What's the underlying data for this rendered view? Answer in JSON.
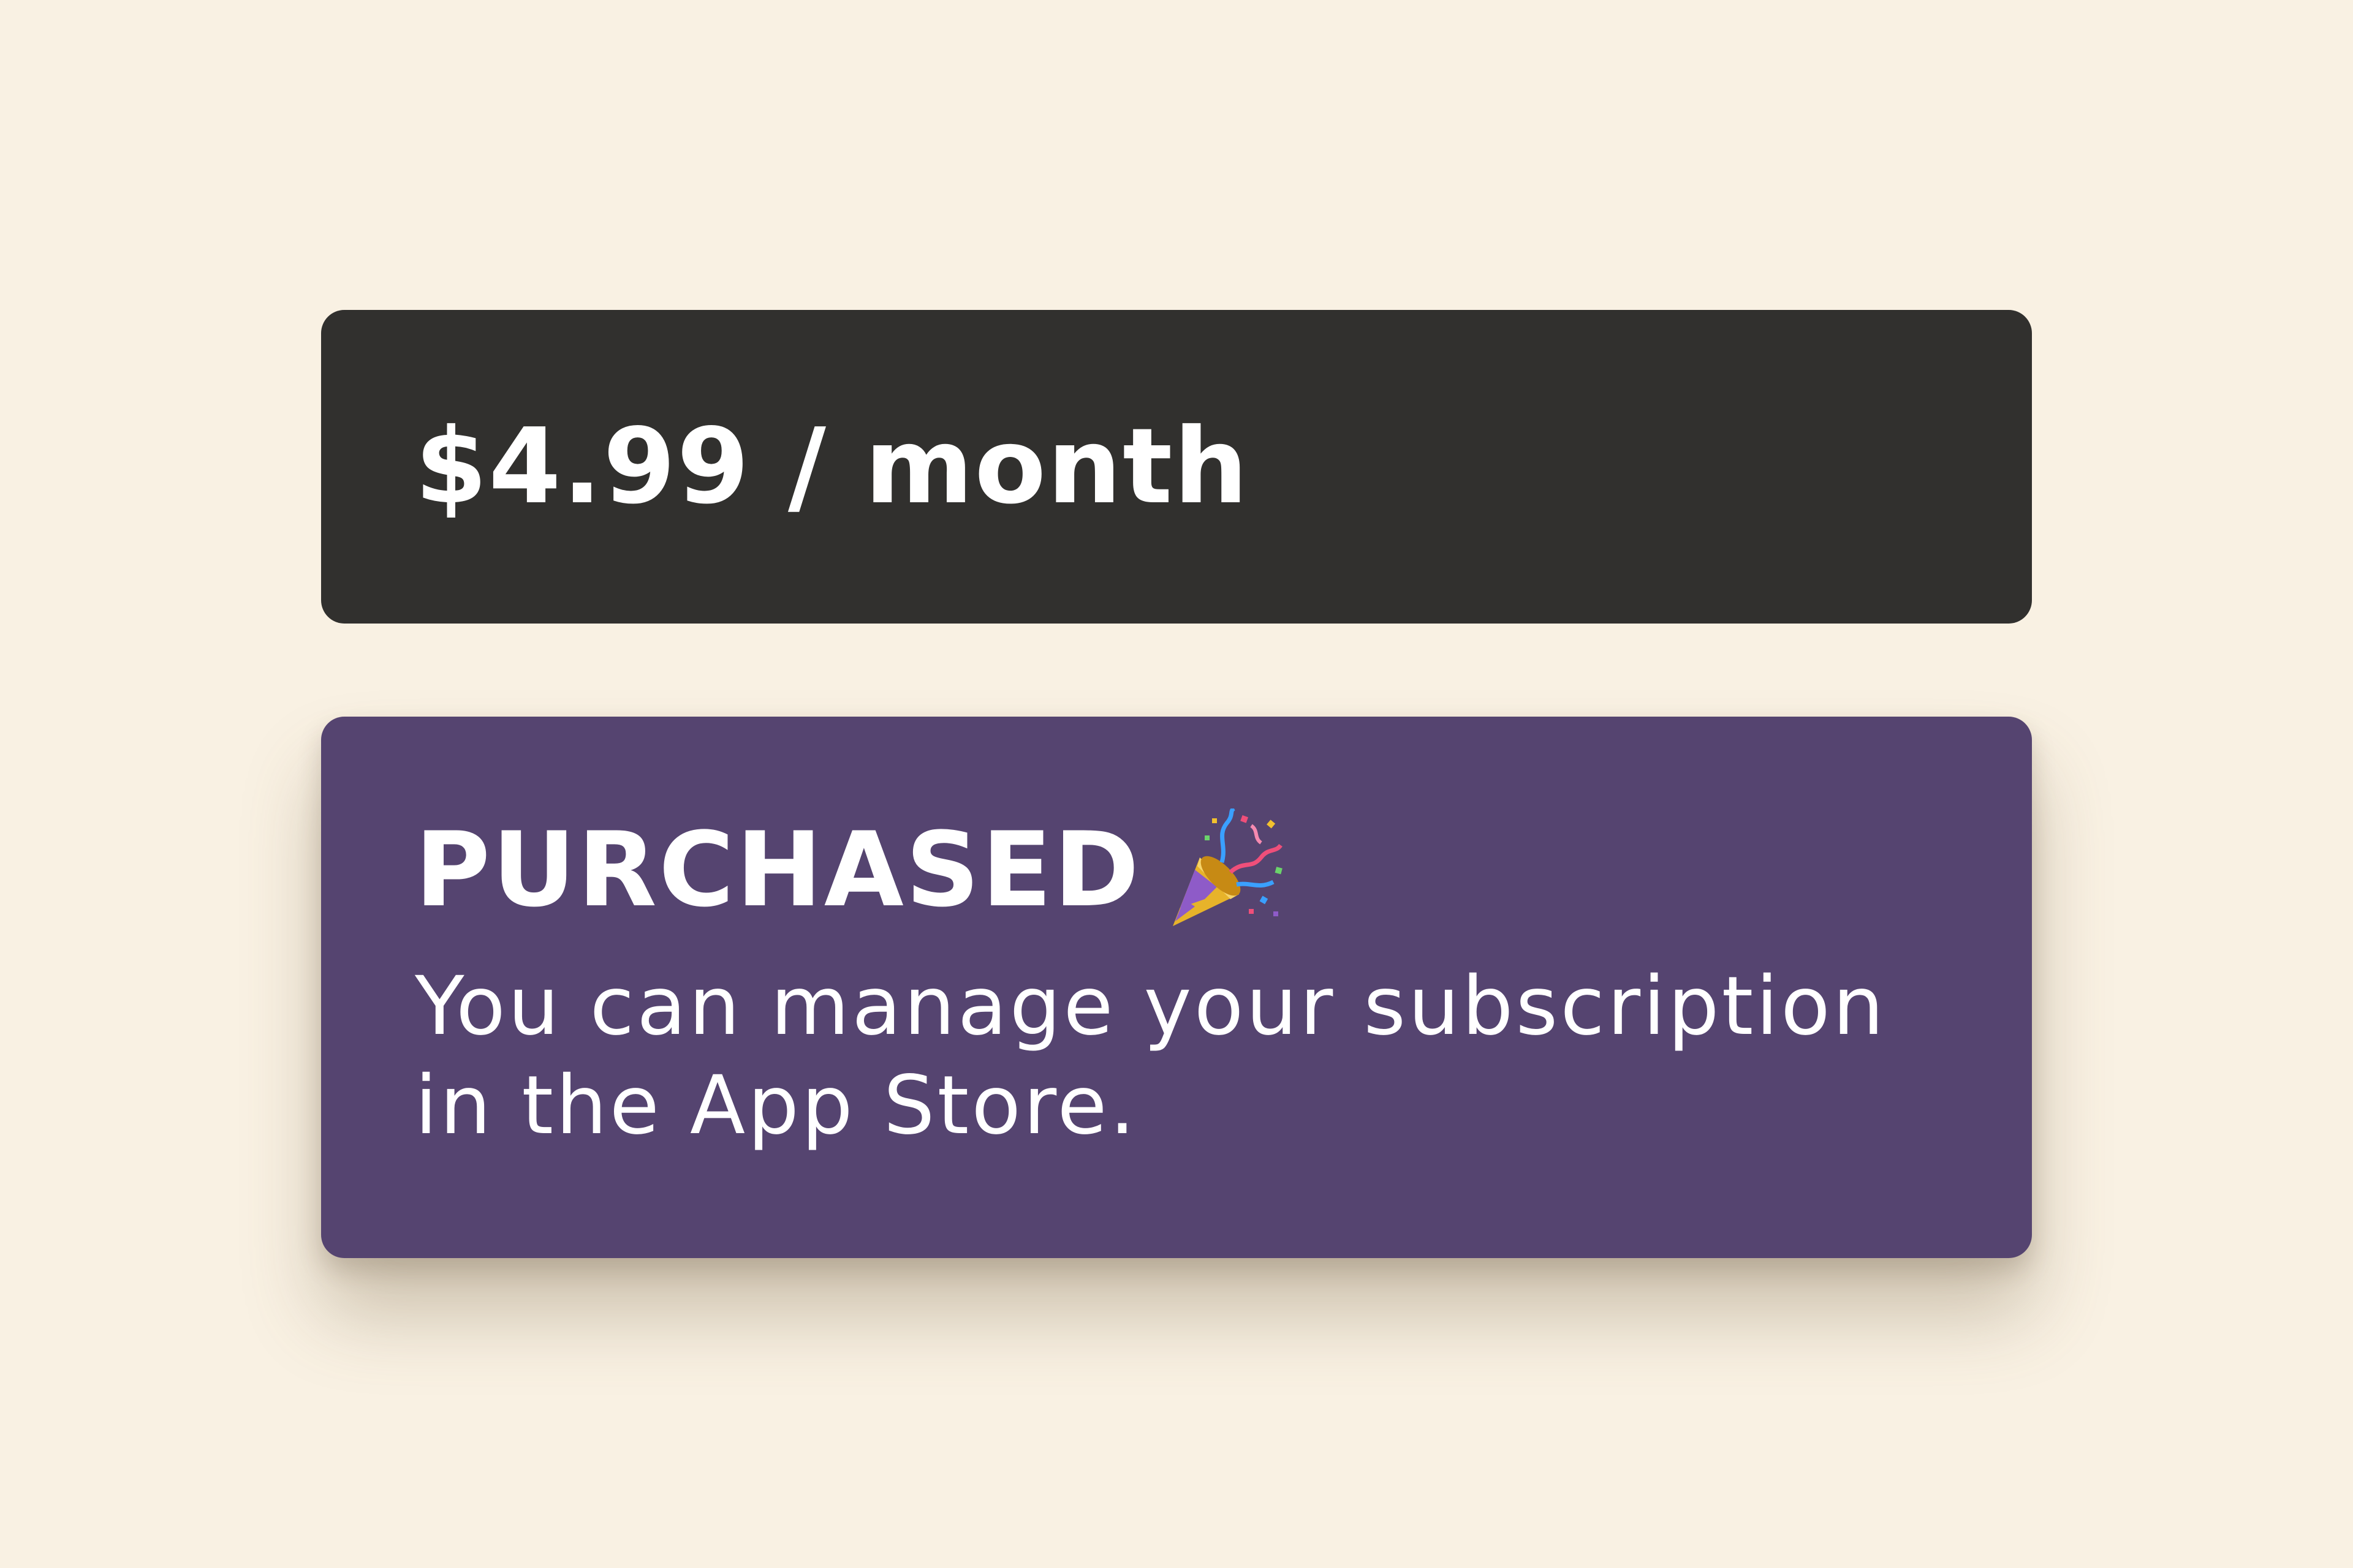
{
  "price_card": {
    "label": "$4.99 / month",
    "background": "#31302e"
  },
  "purchased_card": {
    "title": "PURCHASED",
    "icon": "party-popper-icon",
    "message": "You can manage your subscription in the App Store.",
    "background": "#554470"
  },
  "page": {
    "background": "#f9f1e3"
  }
}
